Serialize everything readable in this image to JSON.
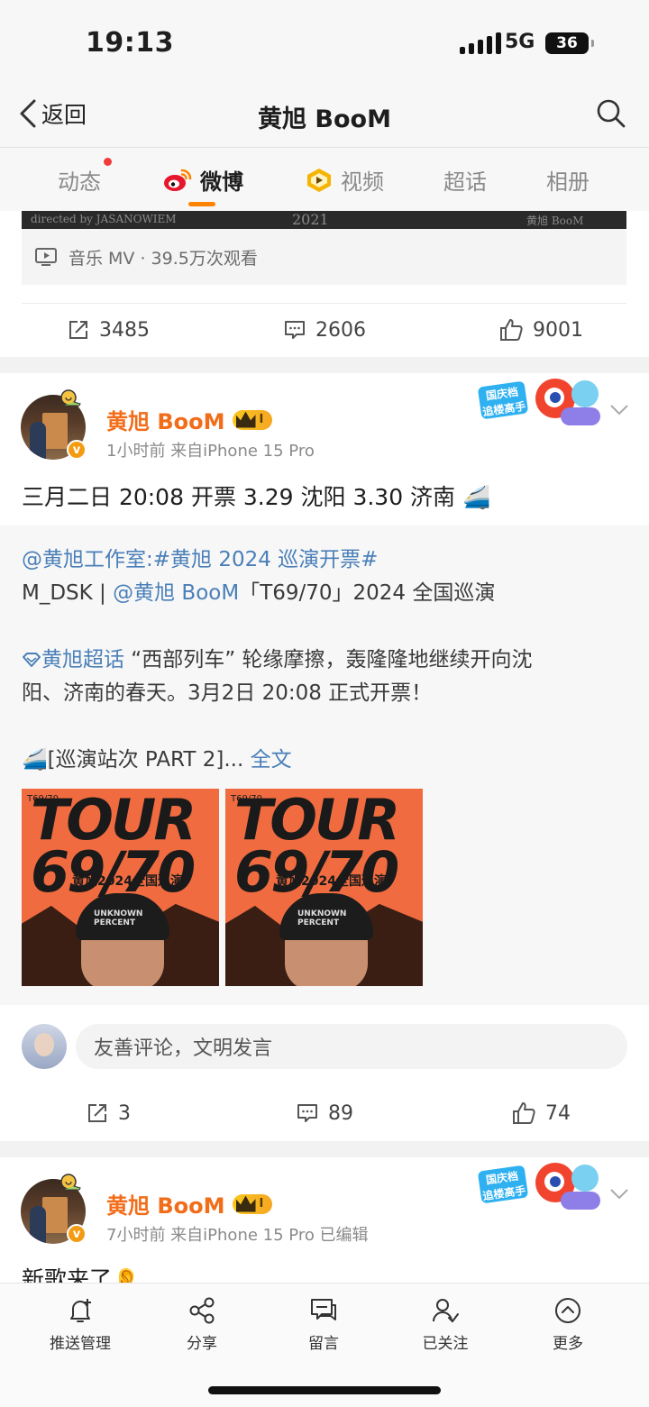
{
  "status_bar": {
    "time": "19:13",
    "network": "5G",
    "battery": "36"
  },
  "nav": {
    "back_label": "返回",
    "title": "黄旭 BooM"
  },
  "tabs": [
    {
      "label": "动态",
      "has_dot": true
    },
    {
      "label": "微博",
      "active": true
    },
    {
      "label": "视频"
    },
    {
      "label": "超话"
    },
    {
      "label": "相册"
    }
  ],
  "post1": {
    "mv_banner_left": "directed by JASANOWIEM",
    "mv_banner_mid": "2021",
    "mv_banner_right": "黄旭 BooM",
    "mv_info": "音乐 MV · 39.5万次观看",
    "reposts": "3485",
    "comments": "2606",
    "likes": "9001"
  },
  "post2": {
    "username": "黄旭 BooM",
    "level": "I",
    "meta": "1小时前  来自iPhone 15 Pro",
    "text": "三月二日 20:08 开票 3.29 沈阳 3.30 济南 🚄",
    "repost": {
      "line1_mention": "@黄旭工作室",
      "line1_sep": ":",
      "line1_tag": "#黄旭 2024 巡演开票#",
      "line2_a": "M_DSK  |  ",
      "line2_mention": "@黄旭 BooM",
      "line2_b": "「T69/70」2024 全国巡演",
      "line3_topic": "黄旭超话",
      "line3_text": " “西部列车” 轮缘摩擦，轰隆隆地继续开向沈",
      "line4_text": "阳、济南的春天。3月2日 20:08 正式开票！",
      "line5_text": "🚄[巡演站次 PART 2]... ",
      "line5_more": "全文"
    },
    "images": [
      {
        "title": "TOUR\n69/70",
        "sub": "黄旭2024全国巡演",
        "t": "T69/70",
        "beanie": "UNKNOWN PERCENT"
      },
      {
        "title": "TOUR\n69/70",
        "sub": "黄旭2024全国巡演",
        "t": "T69/70",
        "beanie": "UNKNOWN PERCENT"
      }
    ],
    "comment_placeholder": "友善评论，文明发言",
    "reposts": "3",
    "comments": "89",
    "likes": "74"
  },
  "post3": {
    "username": "黄旭 BooM",
    "level": "I",
    "meta": "7小时前  来自iPhone 15 Pro  已编辑",
    "text": "新歌来了👂"
  },
  "deco_badge": {
    "line1": "国庆档",
    "line2": "追楼高手"
  },
  "toolbar": [
    {
      "label": "推送管理",
      "icon": "bell-plus-icon"
    },
    {
      "label": "分享",
      "icon": "share-icon"
    },
    {
      "label": "留言",
      "icon": "message-icon"
    },
    {
      "label": "已关注",
      "icon": "user-check-icon"
    },
    {
      "label": "更多",
      "icon": "more-icon"
    }
  ]
}
